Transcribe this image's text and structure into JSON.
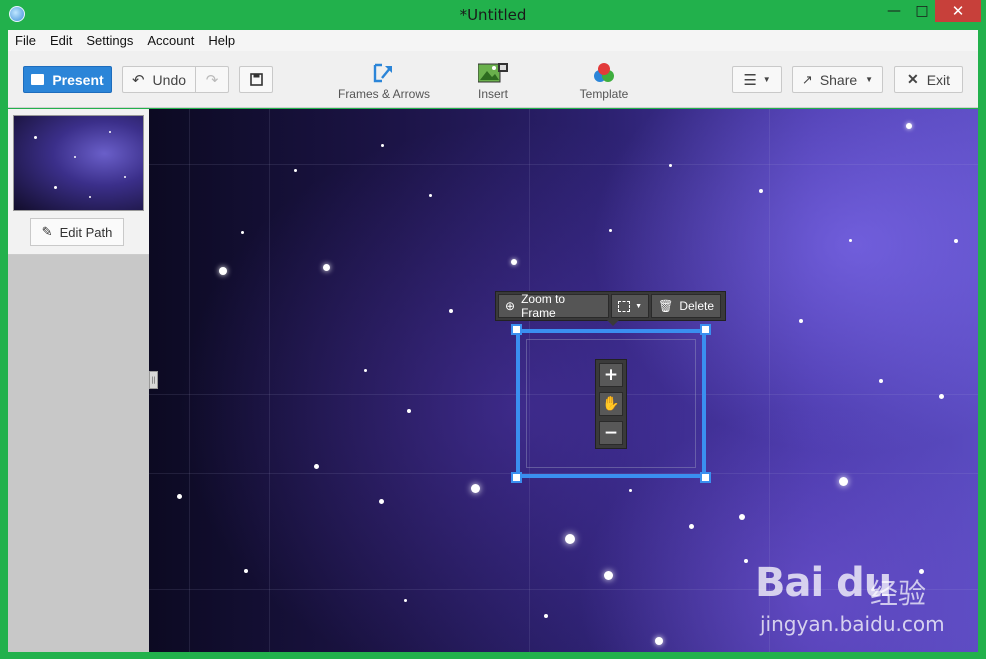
{
  "window": {
    "title": "*Untitled"
  },
  "menu": [
    "File",
    "Edit",
    "Settings",
    "Account",
    "Help"
  ],
  "toolbar": {
    "present_label": "Present",
    "undo_label": "Undo",
    "frames_label": "Frames & Arrows",
    "insert_label": "Insert",
    "template_label": "Template",
    "share_label": "Share",
    "exit_label": "Exit"
  },
  "sidebar": {
    "edit_path_label": "Edit Path"
  },
  "frame_toolbar": {
    "zoom_label": "Zoom to Frame",
    "delete_label": "Delete"
  },
  "zoom_controls": {
    "plus": "+",
    "minus": "−"
  },
  "watermark": {
    "logo": "Bai du",
    "site": "经验",
    "url": "jingyan.baidu.com"
  },
  "colors": {
    "accent": "#2b85d8",
    "frame": "#3a8ff0",
    "window_border": "#22b14c"
  }
}
